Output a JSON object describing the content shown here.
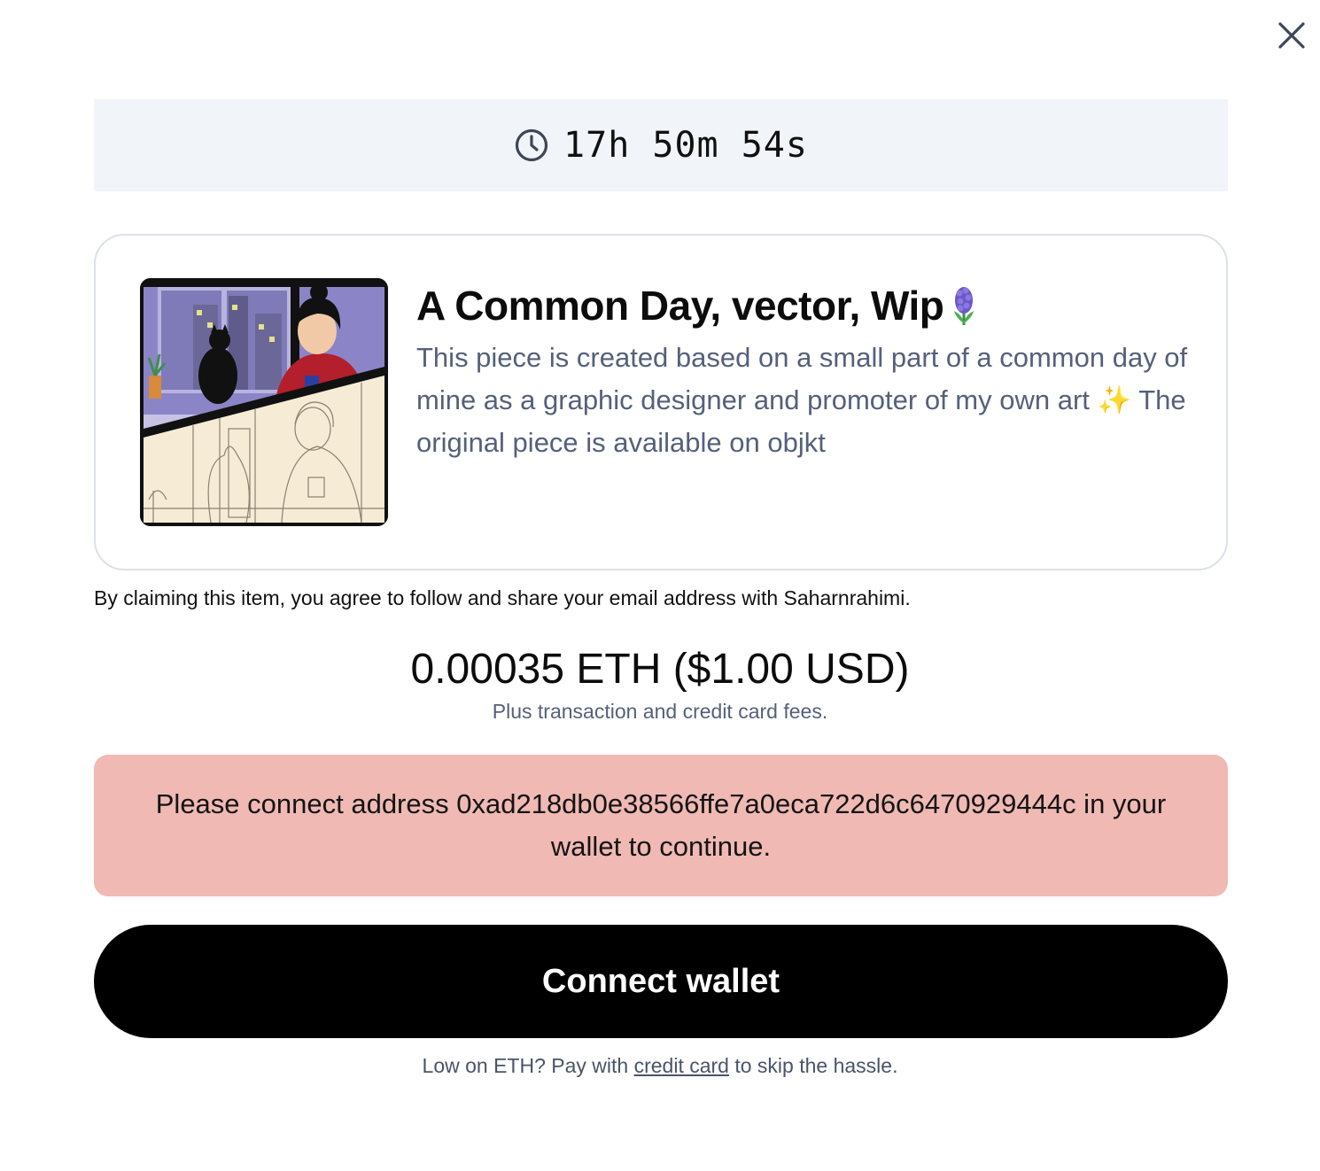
{
  "dialog": {
    "close_icon": "close-icon"
  },
  "timer": {
    "icon": "clock-icon",
    "text": "17h 50m 54s"
  },
  "item": {
    "title": "A Common Day, vector, Wip",
    "title_emoji": "hyacinth-emoji",
    "description_part1": "This piece is created based on a small part of a common day of mine as a graphic designer and promoter of my own art",
    "description_emoji": "✨",
    "description_part2": "The original piece is available on objkt",
    "image": "artwork-thumbnail"
  },
  "consent_text": "By claiming this item, you agree to follow and share your email address with Saharnrahimi.",
  "price": {
    "amount": "0.00035 ETH ($1.00 USD)",
    "fees_note": "Plus transaction and credit card fees."
  },
  "alert": {
    "message": "Please connect address 0xad218db0e38566ffe7a0eca722d6c6470929444c in your wallet to continue.",
    "background_color": "#f0b9b4"
  },
  "connect_button": {
    "label": "Connect wallet"
  },
  "footer": {
    "prefix": "Low on ETH? Pay with",
    "link": "credit card",
    "suffix": "to skip the hassle."
  }
}
